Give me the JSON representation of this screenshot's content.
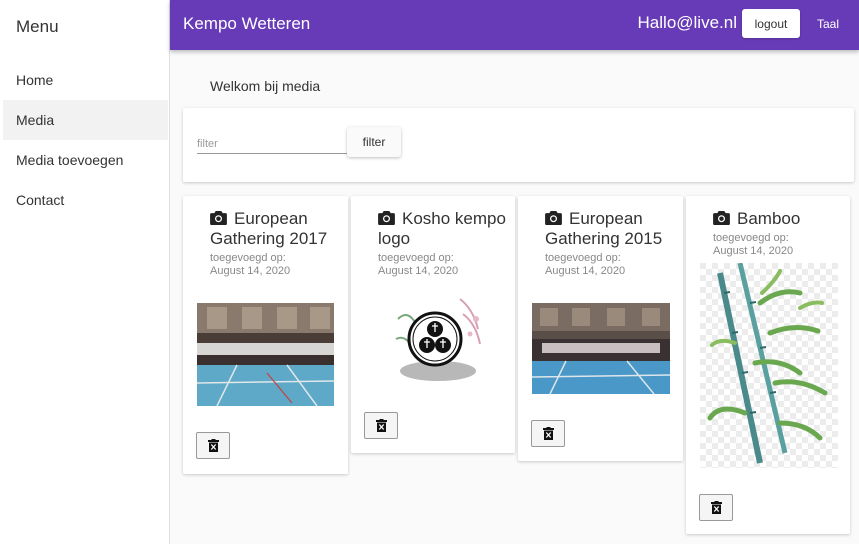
{
  "sidebar": {
    "title": "Menu",
    "items": [
      {
        "label": "Home"
      },
      {
        "label": "Media"
      },
      {
        "label": "Media toevoegen"
      },
      {
        "label": "Contact"
      }
    ]
  },
  "header": {
    "title": "Kempo Wetteren",
    "user_email": "Hallo@live.nl",
    "logout_label": "logout",
    "language_label": "Taal",
    "accent_color": "#673ab7"
  },
  "main": {
    "welcome": "Welkom bij media",
    "filter": {
      "placeholder": "filter",
      "value": "",
      "button_label": "filter"
    },
    "cards": [
      {
        "title": "European Gathering 2017",
        "added_label": "toegevoegd op:",
        "date": "August 14, 2020",
        "icon": "camera-icon"
      },
      {
        "title": "Kosho kempo logo",
        "added_label": "toegevoegd op:",
        "date": "August 14, 2020",
        "icon": "camera-icon"
      },
      {
        "title": "European Gathering 2015",
        "added_label": "toegevoegd op:",
        "date": "August 14, 2020",
        "icon": "camera-icon"
      },
      {
        "title": "Bamboo",
        "added_label": "toegevoegd op:",
        "date": "August 14, 2020",
        "icon": "camera-icon"
      }
    ]
  }
}
